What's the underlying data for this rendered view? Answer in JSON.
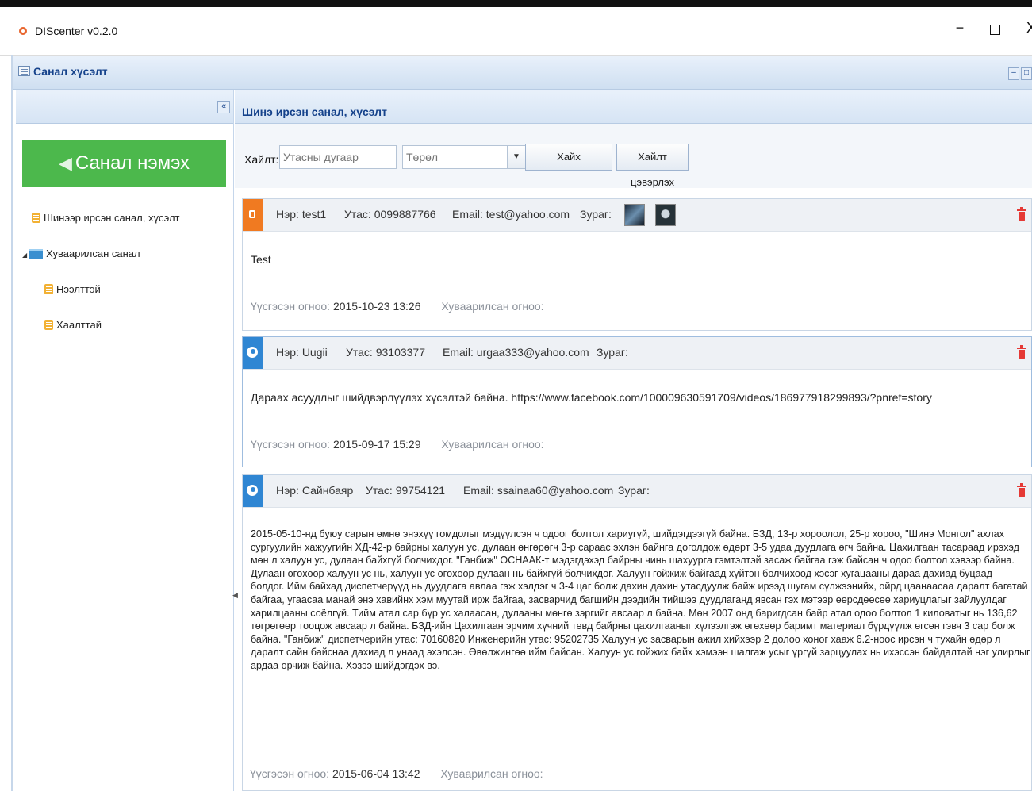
{
  "window": {
    "title": "DIScenter v0.2.0",
    "minimize": "−",
    "close": "X"
  },
  "panel": {
    "title": "Санал хүсэлт"
  },
  "sidebar": {
    "collapse": "«",
    "add_button": "Санал нэмэх",
    "tree": [
      {
        "label": "Шинээр ирсэн санал, хүсэлт"
      },
      {
        "label": "Хуваарилсан санал"
      },
      {
        "label": "Нээлттэй"
      },
      {
        "label": "Хаалттай"
      }
    ]
  },
  "main": {
    "title": "Шинэ ирсэн санал, хүсэлт",
    "search_label": "Хайлт:",
    "phone_placeholder": "Утасны дугаар",
    "type_placeholder": "Төрөл",
    "search_button": "Хайх",
    "clear_button": "Хайлт цэвэрлэх"
  },
  "feedback": [
    {
      "status": "orange",
      "name": "Нэр: test1",
      "phone": "Утас: 0099887766",
      "email": "Email: test@yahoo.com",
      "image_label": "Зураг:",
      "body": "Test",
      "created_label": "Үүсгэсэн огноо:",
      "created": "2015-10-23 13:26",
      "assigned_label": "Хуваарилсан огноо:"
    },
    {
      "status": "blue",
      "name": "Нэр: Uugii",
      "phone": "Утас: 93103377",
      "email": "Email: urgaa333@yahoo.com",
      "image_label": "Зураг:",
      "body": "Дараах асуудлыг шийдвэрлүүлэх хүсэлтэй байна. https://www.facebook.com/100009630591709/videos/186977918299893/?pnref=story",
      "created_label": "Үүсгэсэн огноо:",
      "created": "2015-09-17 15:29",
      "assigned_label": "Хуваарилсан огноо:"
    },
    {
      "status": "blue",
      "name": "Нэр: Сайнбаяр",
      "phone": "Утас: 99754121",
      "email": "Email: ssainaa60@yahoo.com",
      "image_label": "Зураг:",
      "body_lines": [
        "2015-05-10-нд буюу сарын өмнө энэхүү гомдолыг мэдүүлсэн ч одоог болтол хариугүй, шийдэгдээгүй байна. БЗД, 13-р хороолол, 25-р хороо, \"Шинэ Монгол\" ахлах",
        "сургуулийн хажуугийн ХД-42-р байрны халуун ус, дулаан өнгөрөгч 3-р сараас эхлэн байнга доголдож өдөрт 3-5 удаа дуудлага өгч байна. Цахилгаан тасараад ирэхэд",
        "мөн л халуун ус, дулаан байхгүй болчихдог. \"Ганбиж\" ОСНААК-т мэдэгдэхэд байрны чинь шахуурга гэмтэлтэй засаж байгаа гэж байсан ч одоо болтол хэвээр байна.",
        "Дулаан өгөхөөр халуун ус нь, халуун ус өгөхөөр дулаан нь байхгүй болчихдог. Халуун гойжиж байгаад хүйтэн болчихоод хэсэг хугацааны дараа дахиад буцаад",
        "болдог. Ийм байхад диспетчерүүд нь дуудлага авлаа гэж хэлдэг ч 3-4 цаг болж дахин дахин утасдуулж байж ирээд шугам сүлжээнийх, ойрд цаанаасаа даралт багатай",
        "байгаа, угаасаа манай энэ хавийнх хэм муутай ирж байгаа, засварчид багшийн дээдийн тийшээ дуудлаганд явсан гэх мэтээр өөрсдөөсөө хариуцлагыг зайлуулдаг",
        "харилцааны соёлгүй. Тийм атал сар бүр ус халаасан, дулааны мөнгө зэргийг авсаар л байна. Мөн 2007 онд баригдсан байр атал одоо болтол 1 киловатыг нь 136,62",
        "төгрөгөөр тооцож авсаар л байна. БЗД-ийн Цахилгаан эрчим хүчний төвд байрны цахилгааныг хүлээлгэж өгөхөөр баримт материал бүрдүүлж өгсөн гэвч 3 сар болж",
        "байна. \"Ганбиж\" диспетчерийн утас: 70160820 Инженерийн утас: 95202735 Халуун ус засварын ажил хийхээр 2 долоо хоног хааж 6.2-ноос ирсэн ч тухайн өдөр л",
        "даралт сайн байснаа дахиад л унаад эхэлсэн. Өвөлжингөө ийм байсан. Халуун ус гойжих байх хэмээн шалгаж усыг үргүй зарцуулах нь ихэссэн байдалтай нэг улирлыг",
        "ардаа орчиж байна. Хэзээ шийдэгдэх вэ."
      ],
      "created_label": "Үүсгэсэн огноо:",
      "created": "2015-06-04 13:42",
      "assigned_label": "Хуваарилсан огноо:"
    }
  ]
}
